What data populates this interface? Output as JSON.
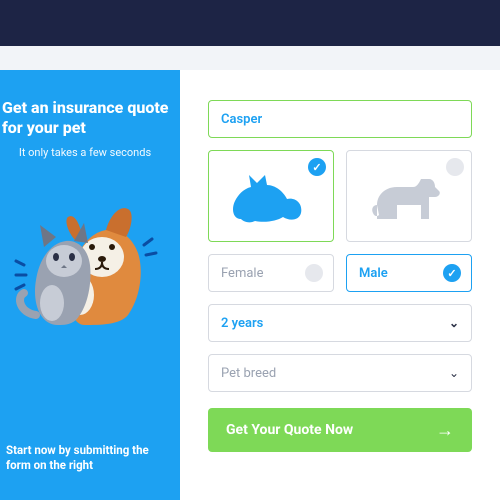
{
  "left": {
    "title": "Get an insurance quote for your pet",
    "subtitle": "It only takes a few seconds",
    "hint": "Start now by submitting the form on the right"
  },
  "form": {
    "name_value": "Casper",
    "pet_options": {
      "cat": "Cat",
      "dog": "Dog",
      "selected": "cat"
    },
    "gender": {
      "female": "Female",
      "male": "Male",
      "selected": "male"
    },
    "age": {
      "value": "2 years"
    },
    "breed": {
      "placeholder": "Pet breed"
    },
    "cta": "Get Your Quote Now"
  },
  "colors": {
    "accent_blue": "#1da1f2",
    "accent_green": "#7ed957",
    "navy": "#1d2445"
  }
}
